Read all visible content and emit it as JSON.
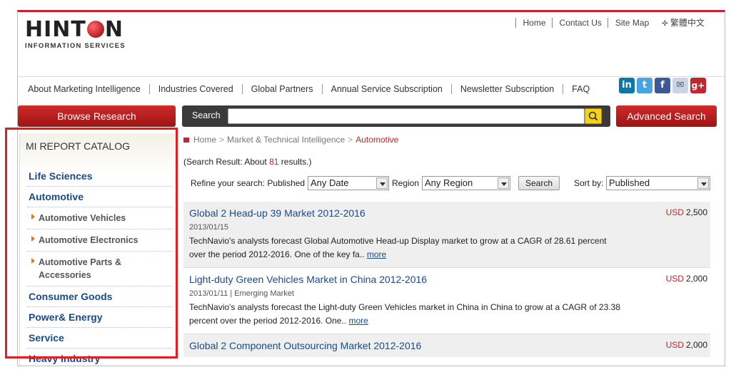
{
  "header": {
    "logo_main_before": "HINT",
    "logo_main_after": "N",
    "logo_sub": "INFORMATION SERVICES",
    "top_links": [
      "Home",
      "Contact Us",
      "Site Map",
      "繁體中文"
    ]
  },
  "nav": {
    "items": [
      "About Marketing Intelligence",
      "Industries Covered",
      "Global Partners",
      "Annual Service Subscription",
      "Newsletter Subscription",
      "FAQ"
    ],
    "social": [
      {
        "icon": "linkedin-icon",
        "glyph": "in",
        "color": "#0e76a8"
      },
      {
        "icon": "twitter-icon",
        "glyph": "t",
        "color": "#4aa3df"
      },
      {
        "icon": "facebook-icon",
        "glyph": "f",
        "color": "#3b5998"
      },
      {
        "icon": "email-icon",
        "glyph": "✉",
        "color": "#c9d4e4"
      },
      {
        "icon": "googleplus-icon",
        "glyph": "g+",
        "color": "#c1272d"
      }
    ]
  },
  "search": {
    "browse_label": "Browse Research",
    "label": "Search",
    "value": "",
    "advanced_label": "Advanced Search"
  },
  "sidebar": {
    "title": "MI REPORT CATALOG",
    "items": [
      {
        "label": "Life Sciences",
        "type": "cat"
      },
      {
        "label": "Automotive",
        "type": "cat"
      },
      {
        "label": "Automotive Vehicles",
        "type": "sub"
      },
      {
        "label": "Automotive Electronics",
        "type": "sub"
      },
      {
        "label": "Automotive Parts & Accessories",
        "type": "sub"
      },
      {
        "label": "Consumer Goods",
        "type": "cat"
      },
      {
        "label": "Power& Energy",
        "type": "cat"
      },
      {
        "label": "Service",
        "type": "cat"
      },
      {
        "label": "Heavy Industry",
        "type": "cat"
      }
    ]
  },
  "breadcrumb": {
    "home": "Home",
    "mid": "Market & Technical Intelligence",
    "current": "Automotive"
  },
  "result_summary": {
    "prefix": "(Search Result: About ",
    "count": "81",
    "suffix": " results.)"
  },
  "refine": {
    "label": "Refine your search: Published",
    "date_value": "Any Date",
    "region_label": "Region",
    "region_value": "Any Region",
    "search_button": "Search",
    "sort_label": "Sort by:",
    "sort_value": "Published"
  },
  "results": [
    {
      "title": "Global 2 Head-up 39 Market 2012-2016",
      "currency": "USD",
      "price": "2,500",
      "meta": "2013/01/15",
      "desc": "TechNavio's analysts forecast Global Automotive Head-up Display market to grow at a CAGR of 28.61 percent over the period 2012-2016. One of the key fa..",
      "more": "more"
    },
    {
      "title": "Light-duty Green Vehicles Market in China 2012-2016",
      "currency": "USD",
      "price": "2,000",
      "meta": "2013/01/11 | Emerging Market",
      "desc": "TechNavio's analysts forecast the Light-duty Green Vehicles market in China in China to grow at a CAGR of 23.38 percent over the period 2012-2016. One..",
      "more": "more"
    },
    {
      "title": "Global 2 Component Outsourcing Market 2012-2016",
      "currency": "USD",
      "price": "2,000",
      "meta": "",
      "desc": "",
      "more": ""
    }
  ]
}
